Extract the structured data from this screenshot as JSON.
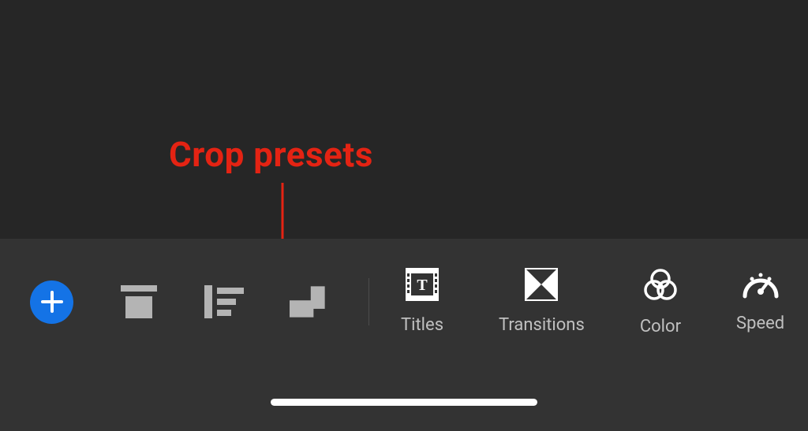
{
  "annotation": {
    "text": "Crop presets"
  },
  "toolbar": {
    "left": {
      "add": "add",
      "project": "project",
      "list": "list",
      "crop_presets": "crop-presets"
    },
    "right": {
      "titles": {
        "label": "Titles"
      },
      "transitions": {
        "label": "Transitions"
      },
      "color": {
        "label": "Color"
      },
      "speed": {
        "label": "Speed"
      }
    }
  }
}
